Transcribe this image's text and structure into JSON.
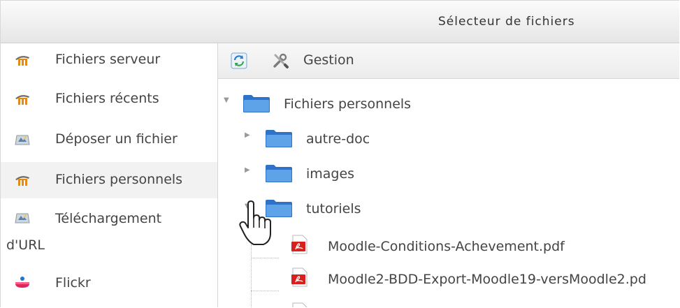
{
  "window": {
    "title": "Sélecteur de fichiers"
  },
  "sidebar": {
    "items": [
      {
        "label": "Fichiers serveur",
        "icon": "moodle-files-icon",
        "active": false
      },
      {
        "label": "Fichiers récents",
        "icon": "moodle-files-icon",
        "active": false
      },
      {
        "label": "Déposer un fichier",
        "icon": "upload-icon",
        "active": false
      },
      {
        "label": "Fichiers personnels",
        "icon": "moodle-files-icon",
        "active": true
      },
      {
        "label": "Téléchargement",
        "label_line2": "d'URL",
        "icon": "upload-icon",
        "active": false
      },
      {
        "label": "Flickr",
        "icon": "flickr-icon",
        "active": false
      }
    ]
  },
  "toolbar": {
    "refresh_icon": "refresh-icon",
    "manage_label": "Gestion",
    "manage_icon": "tools-icon"
  },
  "tree": {
    "root": {
      "label": "Fichiers personnels",
      "expanded": true
    },
    "folders": [
      {
        "label": "autre-doc",
        "expanded": false
      },
      {
        "label": "images",
        "expanded": false
      },
      {
        "label": "tutoriels",
        "expanded": true
      }
    ],
    "files": [
      {
        "label": "Moodle-Conditions-Achevement.pdf",
        "icon": "pdf-icon"
      },
      {
        "label": "Moodle2-BDD-Export-Moodle19-versMoodle2.pd",
        "icon": "pdf-icon"
      }
    ]
  },
  "colors": {
    "folder_blue": "#3f86d8",
    "pdf_red": "#d9201d",
    "active_bg": "#f2f2f2"
  }
}
